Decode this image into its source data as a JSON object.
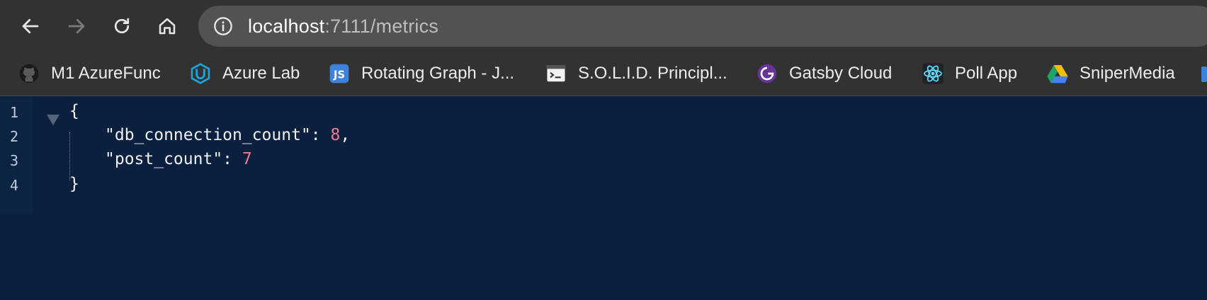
{
  "browser": {
    "url_host": "localhost",
    "url_rest": ":7111/metrics",
    "nav_icons": [
      "back-arrow-icon",
      "forward-arrow-icon",
      "reload-icon",
      "home-icon",
      "info-icon"
    ]
  },
  "bookmarks": [
    {
      "label": "M1 AzureFunc",
      "icon": "github-icon"
    },
    {
      "label": "Azure Lab",
      "icon": "udacity-icon"
    },
    {
      "label": "Rotating Graph - J...",
      "icon": "jsfiddle-icon"
    },
    {
      "label": "S.O.L.I.D. Principl...",
      "icon": "terminal-page-icon"
    },
    {
      "label": "Gatsby Cloud",
      "icon": "gatsby-icon"
    },
    {
      "label": "Poll App",
      "icon": "react-icon"
    },
    {
      "label": "SniperMedia",
      "icon": "google-drive-icon"
    }
  ],
  "json_viewer": {
    "line_numbers": [
      "1",
      "2",
      "3",
      "4"
    ],
    "open_brace": "{",
    "close_brace": "}",
    "entries": [
      {
        "key": "\"db_connection_count\"",
        "value": "8",
        "trailing": ","
      },
      {
        "key": "\"post_count\"",
        "value": "7",
        "trailing": ""
      }
    ],
    "separator": ": "
  },
  "colors": {
    "page_background": "#0b1f3f",
    "number_value": "#f07b8e",
    "toolbar": "#323232",
    "omnibox": "#525252"
  }
}
